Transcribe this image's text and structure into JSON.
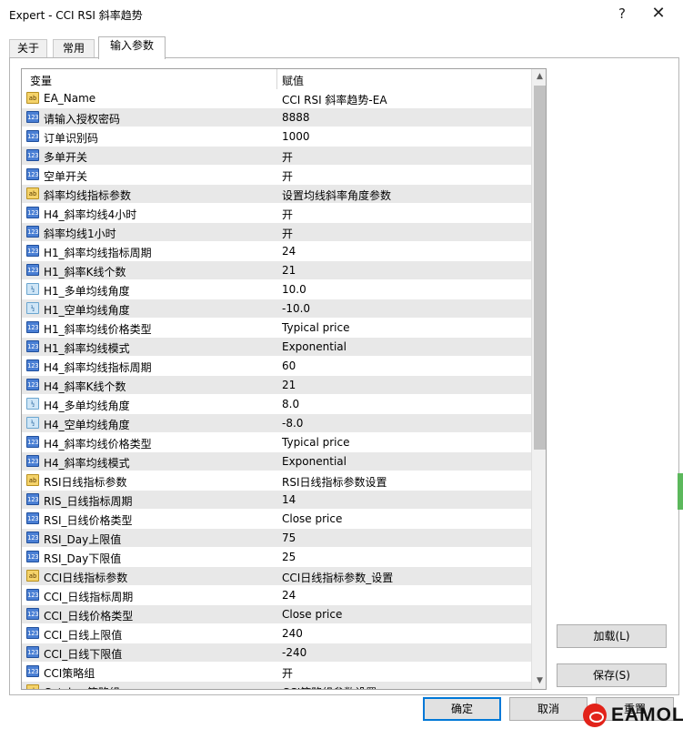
{
  "window": {
    "title": "Expert - CCI RSI 斜率趋势",
    "help_icon": "?",
    "close_icon": "✕"
  },
  "tabs": [
    {
      "label": "关于",
      "active": false
    },
    {
      "label": "常用",
      "active": false
    },
    {
      "label": "输入参数",
      "active": true
    }
  ],
  "grid": {
    "header": {
      "variable": "变量",
      "value": "赋值"
    },
    "rows": [
      {
        "icon": "ab",
        "name": "EA_Name",
        "value": "CCI RSI 斜率趋势-EA"
      },
      {
        "icon": "123",
        "name": "请输入授权密码",
        "value": "8888"
      },
      {
        "icon": "123",
        "name": "订单识别码",
        "value": "1000"
      },
      {
        "icon": "123",
        "name": "多单开关",
        "value": "开"
      },
      {
        "icon": "123",
        "name": "空单开关",
        "value": "开"
      },
      {
        "icon": "ab",
        "name": "斜率均线指标参数",
        "value": "设置均线斜率角度参数"
      },
      {
        "icon": "123",
        "name": "H4_斜率均线4小时",
        "value": "开"
      },
      {
        "icon": "123",
        "name": "斜率均线1小时",
        "value": "开"
      },
      {
        "icon": "123",
        "name": "H1_斜率均线指标周期",
        "value": "24"
      },
      {
        "icon": "123",
        "name": "H1_斜率K线个数",
        "value": "21"
      },
      {
        "icon": "frac",
        "name": "H1_多单均线角度",
        "value": "10.0"
      },
      {
        "icon": "frac",
        "name": "H1_空单均线角度",
        "value": "-10.0"
      },
      {
        "icon": "123",
        "name": "H1_斜率均线价格类型",
        "value": "Typical price"
      },
      {
        "icon": "123",
        "name": "H1_斜率均线模式",
        "value": "Exponential"
      },
      {
        "icon": "123",
        "name": "H4_斜率均线指标周期",
        "value": "60"
      },
      {
        "icon": "123",
        "name": "H4_斜率K线个数",
        "value": "21"
      },
      {
        "icon": "frac",
        "name": "H4_多单均线角度",
        "value": "8.0"
      },
      {
        "icon": "frac",
        "name": "H4_空单均线角度",
        "value": "-8.0"
      },
      {
        "icon": "123",
        "name": "H4_斜率均线价格类型",
        "value": "Typical price"
      },
      {
        "icon": "123",
        "name": "H4_斜率均线模式",
        "value": "Exponential"
      },
      {
        "icon": "ab",
        "name": "RSI日线指标参数",
        "value": "RSI日线指标参数设置"
      },
      {
        "icon": "123",
        "name": "RIS_日线指标周期",
        "value": "14"
      },
      {
        "icon": "123",
        "name": "RSI_日线价格类型",
        "value": "Close price"
      },
      {
        "icon": "123",
        "name": "RSI_Day上限值",
        "value": "75"
      },
      {
        "icon": "123",
        "name": "RSI_Day下限值",
        "value": "25"
      },
      {
        "icon": "ab",
        "name": "CCI日线指标参数",
        "value": "CCI日线指标参数_设置"
      },
      {
        "icon": "123",
        "name": "CCI_日线指标周期",
        "value": "24"
      },
      {
        "icon": "123",
        "name": "CCI_日线价格类型",
        "value": "Close price"
      },
      {
        "icon": "123",
        "name": "CCI_日线上限值",
        "value": "240"
      },
      {
        "icon": "123",
        "name": "CCI_日线下限值",
        "value": "-240"
      },
      {
        "icon": "123",
        "name": "CCI策略组",
        "value": "开"
      },
      {
        "icon": "ab",
        "name": "Catcha_策略组",
        "value": "CCI策略组参数设置"
      }
    ]
  },
  "buttons": {
    "load": "加载(L)",
    "save": "保存(S)",
    "ok": "确定",
    "cancel": "取消",
    "reset": "重置"
  },
  "watermark": {
    "text": "EAMOL"
  },
  "colors": {
    "row_alt": "#e8e8e8",
    "default_button_border": "#0078d7",
    "logo_red": "#e2231a"
  }
}
